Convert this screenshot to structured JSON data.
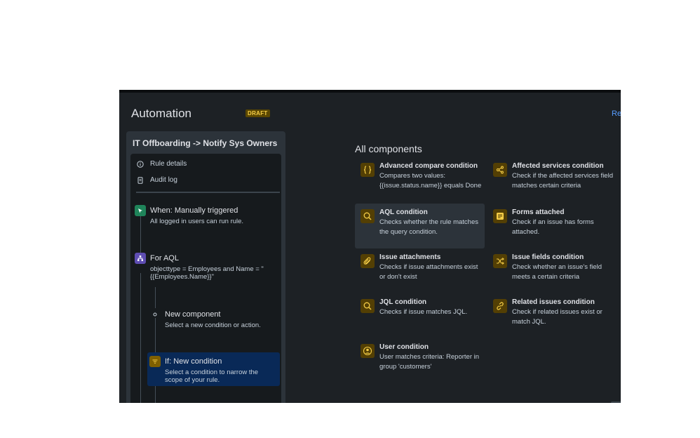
{
  "app": {
    "title": "Automation",
    "badge": "DRAFT",
    "top_right_link": "Ret"
  },
  "sidebar": {
    "rule_title": "IT Offboarding -> Notify Sys Owners",
    "menu": [
      {
        "label": "Rule details",
        "icon": "info-icon"
      },
      {
        "label": "Audit log",
        "icon": "document-icon"
      }
    ],
    "steps": [
      {
        "title": "When: Manually triggered",
        "desc": "All logged in users can run rule.",
        "icon": "trigger-icon",
        "color": "#1f845a"
      },
      {
        "title": "For AQL",
        "desc": "objecttype = Employees and Name = \"{{Employees.Name}}\"",
        "icon": "branch-icon",
        "color": "#5e4db2"
      },
      {
        "title": "New component",
        "desc": "Select a new condition or action.",
        "icon": "component-dot-icon"
      },
      {
        "title": "If: New condition",
        "desc": "Select a condition to narrow the scope of your rule.",
        "icon": "filter-icon",
        "color": "#7f5f01"
      }
    ]
  },
  "components": {
    "heading": "All components",
    "items": [
      {
        "title": "Advanced compare condition",
        "desc": "Compares two values: {{issue.status.name}} equals Done",
        "icon": "braces-icon"
      },
      {
        "title": "Affected services condition",
        "desc": "Check if the affected services field matches certain criteria",
        "icon": "services-icon"
      },
      {
        "title": "AQL condition",
        "desc": "Checks whether the rule matches the query condition.",
        "icon": "search-icon"
      },
      {
        "title": "Forms attached",
        "desc": "Check if an issue has forms attached.",
        "icon": "form-icon"
      },
      {
        "title": "Issue attachments",
        "desc": "Checks if issue attachments exist or don't exist",
        "icon": "paperclip-icon"
      },
      {
        "title": "Issue fields condition",
        "desc": "Check whether an issue's field meets a certain criteria",
        "icon": "shuffle-icon"
      },
      {
        "title": "JQL condition",
        "desc": "Checks if issue matches JQL.",
        "icon": "search-icon"
      },
      {
        "title": "Related issues condition",
        "desc": "Check if related issues exist or match JQL.",
        "icon": "link-icon"
      },
      {
        "title": "User condition",
        "desc": "User matches criteria: Reporter in group 'customers'",
        "icon": "user-icon"
      }
    ]
  },
  "colors": {
    "accent": "#f5cd47",
    "link": "#579dff",
    "selected": "#092957"
  }
}
